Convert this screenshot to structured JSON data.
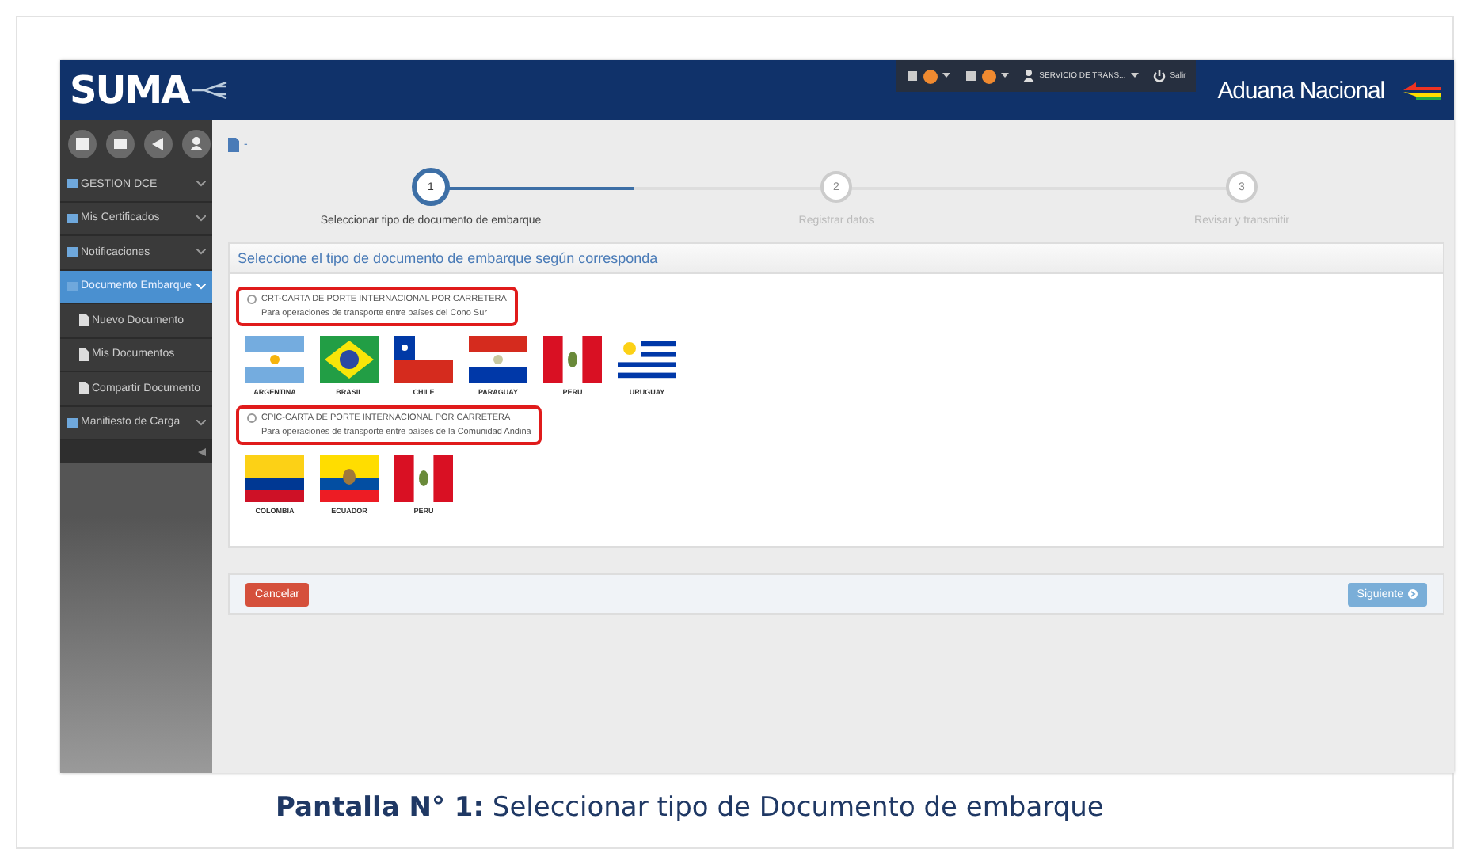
{
  "header": {
    "logo": "SUMA",
    "toolbar": [
      {
        "kind": "notice"
      },
      {
        "kind": "notice"
      },
      {
        "kind": "user",
        "label": "SERVICIO DE TRANS..."
      },
      {
        "kind": "power",
        "label": "Salir"
      }
    ],
    "brand": "Aduana Nacional"
  },
  "sidebar": {
    "items": [
      {
        "label": "GESTION DCE",
        "selected": false
      },
      {
        "label": "Mis Certificados",
        "selected": false
      },
      {
        "label": "Notificaciones",
        "selected": false
      },
      {
        "label": "Documento Embarque",
        "selected": true,
        "children": [
          {
            "label": "Nuevo Documento"
          },
          {
            "label": "Mis Documentos"
          },
          {
            "label": "Compartir Documento"
          }
        ]
      },
      {
        "label": "Manifiesto de Carga",
        "selected": false
      }
    ]
  },
  "breadcrumb": "-",
  "steps": [
    {
      "number": "1",
      "label": "Seleccionar tipo de documento de embarque",
      "selected": true
    },
    {
      "number": "2",
      "label": "Registrar datos",
      "selected": false
    },
    {
      "number": "3",
      "label": "Revisar y transmitir",
      "selected": false
    }
  ],
  "panel": {
    "heading": "Seleccione el tipo de documento de embarque según corresponda",
    "options": [
      {
        "title": "CRT-CARTA DE PORTE INTERNACIONAL POR CARRETERA",
        "subtitle": "Para operaciones de transporte entre países del Cono Sur",
        "selected": false,
        "highlighted": true,
        "flags": [
          {
            "kind": "ar",
            "name": "ARGENTINA"
          },
          {
            "kind": "br",
            "name": "BRASIL"
          },
          {
            "kind": "cl",
            "name": "CHILE"
          },
          {
            "kind": "py",
            "name": "PARAGUAY"
          },
          {
            "kind": "pe",
            "name": "PERU"
          },
          {
            "kind": "uy",
            "name": "URUGUAY"
          }
        ]
      },
      {
        "title": "CPIC-CARTA DE PORTE INTERNACIONAL POR CARRETERA",
        "subtitle": "Para operaciones de transporte entre países de la Comunidad Andina",
        "selected": false,
        "highlighted": true,
        "flags": [
          {
            "kind": "co",
            "name": "COLOMBIA"
          },
          {
            "kind": "ec",
            "name": "ECUADOR"
          },
          {
            "kind": "pe",
            "name": "PERU"
          }
        ]
      }
    ]
  },
  "buttons": [
    {
      "kind": "cancel",
      "label": "Cancelar"
    },
    {
      "kind": "next",
      "label": "Siguiente"
    }
  ],
  "caption": "**Pantalla N° 1:** Seleccionar tipo de Documento de embarque"
}
